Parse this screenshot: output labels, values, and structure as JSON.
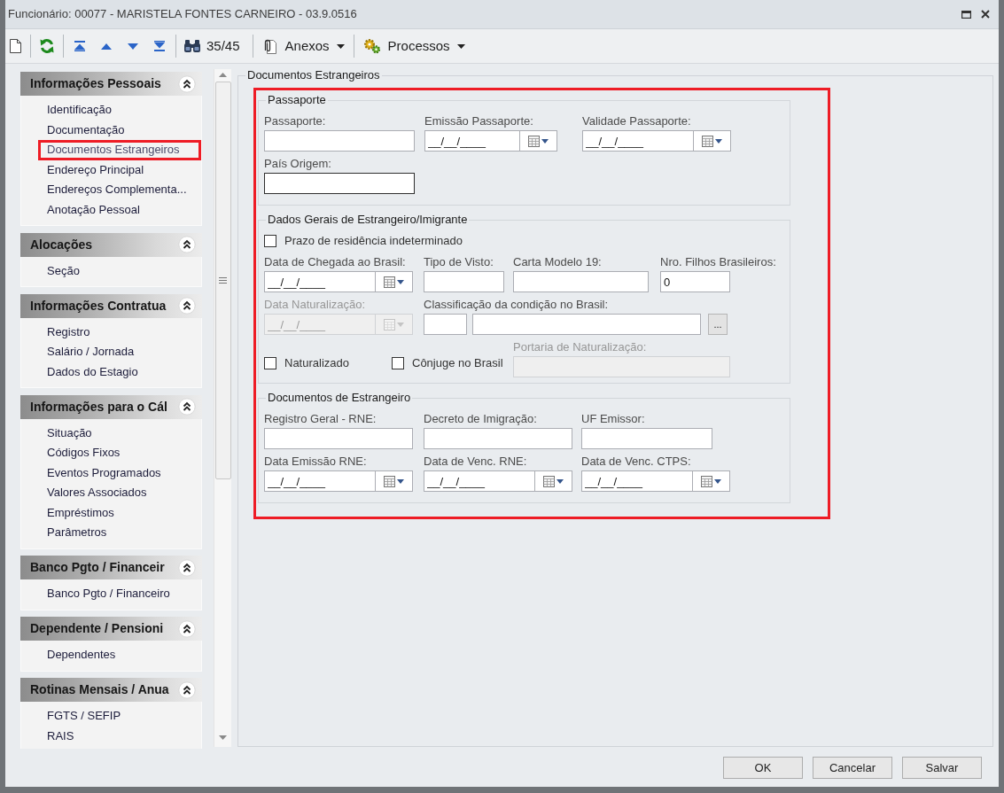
{
  "window": {
    "title": "Funcionário: 00077 - MARISTELA FONTES CARNEIRO - 03.9.0516"
  },
  "toolbar": {
    "record_counter": "35/45",
    "menus": [
      {
        "label": "Anexos"
      },
      {
        "label": "Processos"
      }
    ]
  },
  "sidebar": {
    "groups": [
      {
        "title": "Informações Pessoais",
        "expanded": true,
        "items": [
          {
            "label": "Identificação",
            "highlighted": false
          },
          {
            "label": "Documentação",
            "highlighted": false
          },
          {
            "label": "Documentos Estrangeiros",
            "highlighted": true
          },
          {
            "label": "Endereço Principal",
            "highlighted": false
          },
          {
            "label": "Endereços Complementa...",
            "highlighted": false
          },
          {
            "label": "Anotação Pessoal",
            "highlighted": false
          }
        ]
      },
      {
        "title": "Alocações",
        "expanded": true,
        "items": [
          {
            "label": "Seção",
            "highlighted": false
          }
        ]
      },
      {
        "title": "Informações Contratua",
        "expanded": true,
        "items": [
          {
            "label": "Registro",
            "highlighted": false
          },
          {
            "label": "Salário / Jornada",
            "highlighted": false
          },
          {
            "label": "Dados do Estagio",
            "highlighted": false
          }
        ]
      },
      {
        "title": "Informações para o Cál",
        "expanded": true,
        "items": [
          {
            "label": "Situação",
            "highlighted": false
          },
          {
            "label": "Códigos Fixos",
            "highlighted": false
          },
          {
            "label": "Eventos Programados",
            "highlighted": false
          },
          {
            "label": "Valores Associados",
            "highlighted": false
          },
          {
            "label": "Empréstimos",
            "highlighted": false
          },
          {
            "label": "Parâmetros",
            "highlighted": false
          }
        ]
      },
      {
        "title": "Banco Pgto / Financeir",
        "expanded": true,
        "items": [
          {
            "label": "Banco Pgto / Financeiro",
            "highlighted": false
          }
        ]
      },
      {
        "title": "Dependente / Pensioni",
        "expanded": true,
        "items": [
          {
            "label": "Dependentes",
            "highlighted": false
          }
        ]
      },
      {
        "title": "Rotinas Mensais / Anua",
        "expanded": true,
        "items": [
          {
            "label": "FGTS / SEFIP",
            "highlighted": false
          },
          {
            "label": "RAIS",
            "highlighted": false
          }
        ]
      }
    ]
  },
  "panel": {
    "title": "Documentos Estrangeiros",
    "highlighted": true,
    "groups": [
      {
        "title": "Passaporte",
        "rows": [
          {
            "fields": [
              {
                "kind": "text",
                "label": "Passaporte:",
                "disabled": false,
                "focused": false
              },
              {
                "kind": "date",
                "label": "Emissão Passaporte:",
                "value": "__/__/____",
                "disabled": false,
                "focused": false
              },
              {
                "kind": "date",
                "label": "Validade Passaporte:",
                "value": "__/__/____",
                "disabled": false,
                "focused": false
              }
            ]
          },
          {
            "fields": [
              {
                "kind": "text",
                "label": "País Origem:",
                "disabled": false,
                "focused": true
              }
            ]
          }
        ]
      },
      {
        "title": "Dados Gerais de Estrangeiro/Imigrante",
        "rows": [
          {
            "fields": [
              {
                "kind": "checkbox",
                "label": "Prazo de residência indeterminado",
                "checked": false
              }
            ]
          },
          {
            "fields": [
              {
                "kind": "date",
                "label": "Data de Chegada ao Brasil:",
                "value": "__/__/____",
                "disabled": false,
                "focused": false
              },
              {
                "kind": "text",
                "label": "Tipo de Visto:",
                "disabled": false,
                "focused": false
              },
              {
                "kind": "text",
                "label": "Carta Modelo 19:",
                "disabled": false,
                "focused": false
              },
              {
                "kind": "text",
                "label": "Nro. Filhos Brasileiros:",
                "value": "0",
                "disabled": false,
                "focused": false
              }
            ]
          },
          {
            "fields": [
              {
                "kind": "date",
                "label": "Data Naturalização:",
                "value": "__/__/____",
                "disabled": true,
                "focused": false
              },
              {
                "kind": "lookup",
                "label": "Classificação da condição no Brasil:",
                "button": "...",
                "disabled": false,
                "focused": false
              }
            ]
          },
          {
            "fields": [
              {
                "kind": "checkbox",
                "label": "Naturalizado",
                "checked": false
              },
              {
                "kind": "checkbox",
                "label": "Cônjuge no Brasil",
                "checked": false
              },
              {
                "kind": "text",
                "label": "Portaria de Naturalização:",
                "disabled": true,
                "focused": false
              }
            ]
          }
        ]
      },
      {
        "title": "Documentos de Estrangeiro",
        "rows": [
          {
            "fields": [
              {
                "kind": "text",
                "label": "Registro Geral - RNE:",
                "disabled": false,
                "focused": false
              },
              {
                "kind": "text",
                "label": "Decreto de Imigração:",
                "disabled": false,
                "focused": false
              },
              {
                "kind": "text",
                "label": "UF Emissor:",
                "disabled": false,
                "focused": false
              }
            ]
          },
          {
            "fields": [
              {
                "kind": "date",
                "label": "Data Emissão RNE:",
                "value": "__/__/____",
                "disabled": false,
                "focused": false
              },
              {
                "kind": "date",
                "label": "Data de Venc. RNE:",
                "value": "__/__/____",
                "disabled": false,
                "focused": false
              },
              {
                "kind": "date",
                "label": "Data de Venc. CTPS:",
                "value": "__/__/____",
                "disabled": false,
                "focused": false
              }
            ]
          }
        ]
      }
    ]
  },
  "buttons": [
    "OK",
    "Cancelar",
    "Salvar"
  ]
}
